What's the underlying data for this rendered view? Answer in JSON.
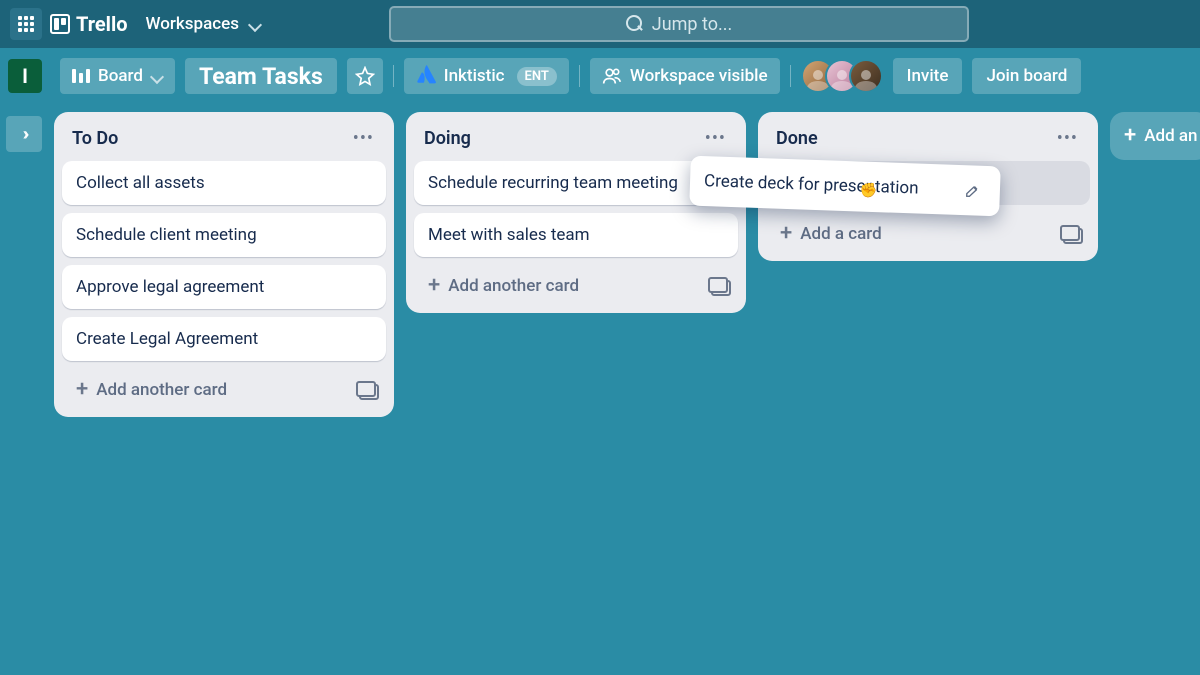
{
  "topbar": {
    "logo_text": "Trello",
    "workspaces_label": "Workspaces",
    "search_placeholder": "Jump to..."
  },
  "boardbar": {
    "workspace_initial": "I",
    "view_label": "Board",
    "board_title": "Team Tasks",
    "org_name": "Inktistic",
    "org_badge": "ENT",
    "visibility_label": "Workspace visible",
    "invite_label": "Invite",
    "join_label": "Join board"
  },
  "lists": [
    {
      "title": "To Do",
      "cards": [
        "Collect all assets",
        "Schedule client meeting",
        "Approve legal agreement",
        "Create Legal Agreement"
      ],
      "add_label": "Add another card"
    },
    {
      "title": "Doing",
      "cards": [
        "Schedule recurring team meeting",
        "Meet with sales team"
      ],
      "add_label": "Add another card"
    },
    {
      "title": "Done",
      "cards": [],
      "add_label": "Add a card",
      "has_placeholder": true
    }
  ],
  "dragging_card": "Create deck for presentation",
  "add_list_label": "Add an"
}
